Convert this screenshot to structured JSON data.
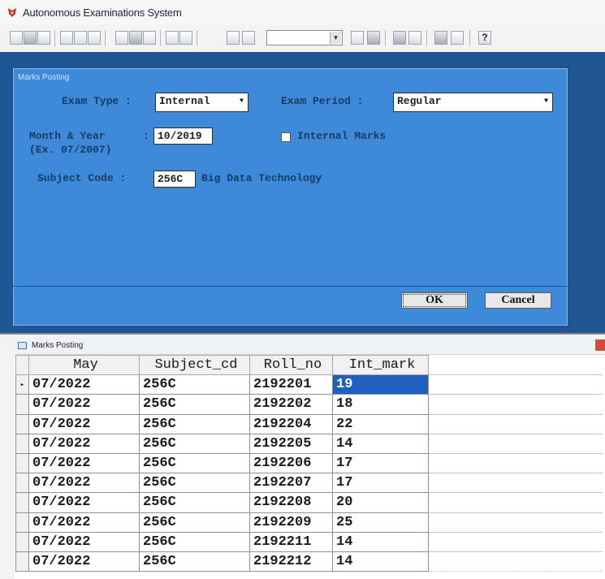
{
  "app": {
    "title": "Autonomous Examinations System"
  },
  "toolbar": {
    "combo_value": "",
    "help_glyph": "?"
  },
  "dialog": {
    "title": "Marks Posting",
    "exam_type_label": "Exam Type :",
    "exam_type_value": "Internal",
    "exam_period_label": "Exam Period :",
    "exam_period_value": "Regular",
    "month_year_label": "Month & Year",
    "month_year_example": "(Ex. 07/2007)",
    "month_year_colon": ":",
    "month_year_value": "10/2019",
    "internal_marks_label": "Internal Marks",
    "internal_marks_checked": false,
    "subject_code_label": "Subject Code :",
    "subject_code_value": "256C",
    "subject_name": "Big Data Technology",
    "ok_label": "OK",
    "cancel_label": "Cancel"
  },
  "grid": {
    "title": "Marks Posting",
    "columns": [
      "May",
      "Subject_cd",
      "Roll_no",
      "Int_mark"
    ],
    "rows": [
      [
        "07/2022",
        "256C",
        "2192201",
        "19"
      ],
      [
        "07/2022",
        "256C",
        "2192202",
        "18"
      ],
      [
        "07/2022",
        "256C",
        "2192204",
        "22"
      ],
      [
        "07/2022",
        "256C",
        "2192205",
        "14"
      ],
      [
        "07/2022",
        "256C",
        "2192206",
        "17"
      ],
      [
        "07/2022",
        "256C",
        "2192207",
        "17"
      ],
      [
        "07/2022",
        "256C",
        "2192208",
        "20"
      ],
      [
        "07/2022",
        "256C",
        "2192209",
        "25"
      ],
      [
        "07/2022",
        "256C",
        "2192211",
        "14"
      ],
      [
        "07/2022",
        "256C",
        "2192212",
        "14"
      ]
    ],
    "current_row_marker": "▸",
    "selected_cell": "row 0, Int_mark"
  },
  "colors": {
    "dialog_bg": "#3f8ad8",
    "desktop_bg": "#1f5794",
    "selection": "#1f5fbf"
  }
}
